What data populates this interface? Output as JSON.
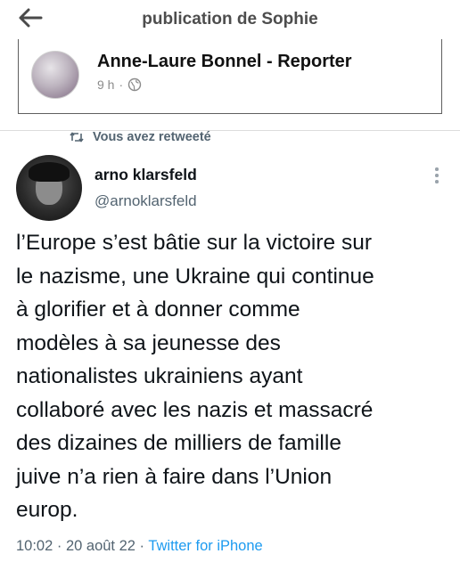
{
  "header": {
    "title": "publication de Sophie"
  },
  "shared_post": {
    "author": "Anne-Laure Bonnel - Reporter",
    "time": "9 h",
    "separator": "·",
    "visibility_icon": "globe-icon"
  },
  "retweet": {
    "label": "Vous avez retweeté",
    "icon": "retweet-icon"
  },
  "tweet": {
    "name": "arno klarsfeld",
    "handle": "@arnoklarsfeld",
    "text": "l’Europe s’est bâtie sur la victoire sur\nle nazisme, une Ukraine qui continue\nà glorifier et à donner comme\nmodèles à sa jeunesse des\nnationalistes ukrainiens ayant\ncollaboré avec les nazis et massacré\ndes dizaines de milliers de famille\njuive n’a rien à faire dans l’Union\neurop.",
    "time": "10:02 · 20 août 22 · ",
    "source": "Twitter for iPhone"
  },
  "colors": {
    "link": "#1d9bf0",
    "secondary_text": "#536471",
    "title_text": "#4d4d4d"
  }
}
